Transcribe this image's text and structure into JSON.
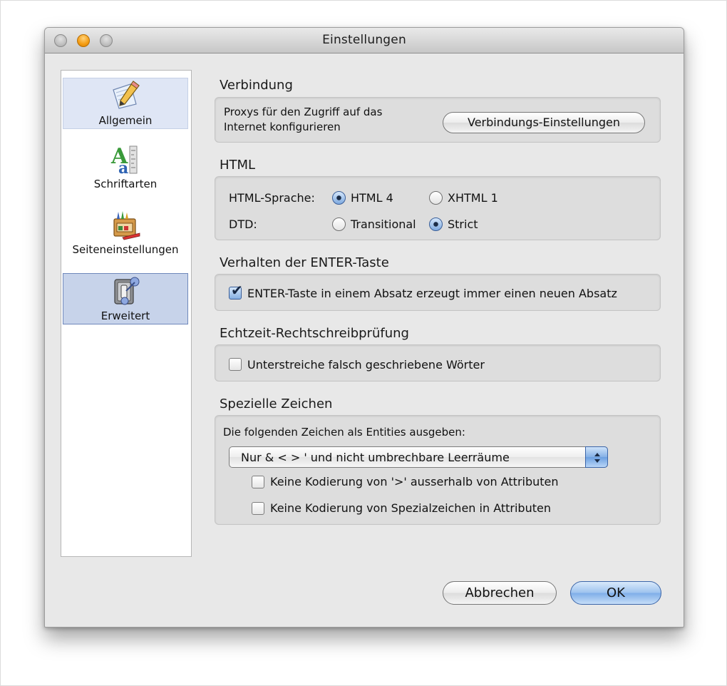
{
  "window": {
    "title": "Einstellungen"
  },
  "sidebar": {
    "items": [
      {
        "label": "Allgemein",
        "icon": "pencil-paper-icon"
      },
      {
        "label": "Schriftarten",
        "icon": "font-letters-icon"
      },
      {
        "label": "Seiteneinstellungen",
        "icon": "paint-box-icon"
      },
      {
        "label": "Erweitert",
        "icon": "switch-icon"
      }
    ]
  },
  "connection": {
    "title": "Verbindung",
    "description_line1": "Proxys für den Zugriff auf das",
    "description_line2": "Internet konfigurieren",
    "button_label": "Verbindungs-Einstellungen"
  },
  "html": {
    "title": "HTML",
    "language_label": "HTML-Sprache:",
    "language_options": [
      "HTML 4",
      "XHTML 1"
    ],
    "language_selected": "HTML 4",
    "dtd_label": "DTD:",
    "dtd_options": [
      "Transitional",
      "Strict"
    ],
    "dtd_selected": "Strict"
  },
  "enter_key": {
    "title": "Verhalten der ENTER-Taste",
    "checkbox_label": "ENTER-Taste in einem Absatz erzeugt immer einen neuen Absatz",
    "checked": true
  },
  "spellcheck": {
    "title": "Echtzeit-Rechtschreibprüfung",
    "checkbox_label": "Unterstreiche falsch geschriebene Wörter",
    "checked": false
  },
  "special_chars": {
    "title": "Spezielle Zeichen",
    "description": "Die folgenden Zeichen als Entities ausgeben:",
    "select_value": "Nur & < > ' und nicht umbrechbare Leerräume",
    "option1_label": "Keine Kodierung von '>' ausserhalb von Attributen",
    "option1_checked": false,
    "option2_label": "Keine Kodierung von Spezialzeichen in Attributen",
    "option2_checked": false
  },
  "footer": {
    "cancel_label": "Abbrechen",
    "ok_label": "OK"
  }
}
